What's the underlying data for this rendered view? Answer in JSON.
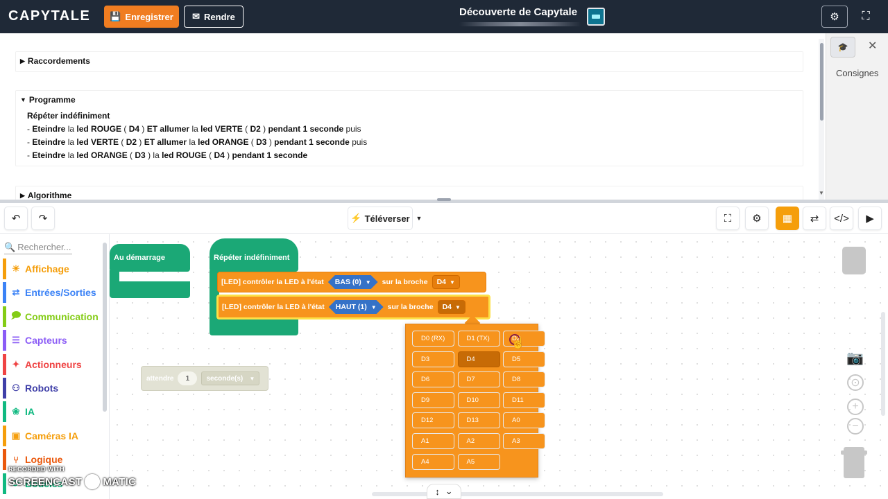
{
  "header": {
    "brand": "CAPYTALE",
    "save_label": "Enregistrer",
    "render_label": "Rendre",
    "doc_title": "Découverte de Capytale"
  },
  "instructions": {
    "sections": {
      "raccordements": "Raccordements",
      "programme": "Programme",
      "algorithme": "Algorithme"
    },
    "programme_body": {
      "intro": "Répéter indéfiniment",
      "lines": [
        [
          {
            "t": "- ",
            "b": false
          },
          {
            "t": "Eteindre",
            "b": true
          },
          {
            "t": " la ",
            "b": false
          },
          {
            "t": "led ROUGE",
            "b": true
          },
          {
            "t": " ( ",
            "b": false
          },
          {
            "t": "D4",
            "b": true
          },
          {
            "t": " ) ",
            "b": false
          },
          {
            "t": "ET allumer",
            "b": true
          },
          {
            "t": " la ",
            "b": false
          },
          {
            "t": "led VERTE",
            "b": true
          },
          {
            "t": " ( ",
            "b": false
          },
          {
            "t": "D2",
            "b": true
          },
          {
            "t": " ) ",
            "b": false
          },
          {
            "t": "pendant 1 seconde",
            "b": true
          },
          {
            "t": " puis",
            "b": false
          }
        ],
        [
          {
            "t": "- ",
            "b": false
          },
          {
            "t": "Eteindre",
            "b": true
          },
          {
            "t": " la ",
            "b": false
          },
          {
            "t": "led VERTE",
            "b": true
          },
          {
            "t": " ( ",
            "b": false
          },
          {
            "t": "D2",
            "b": true
          },
          {
            "t": " ) ",
            "b": false
          },
          {
            "t": "ET allumer",
            "b": true
          },
          {
            "t": " la ",
            "b": false
          },
          {
            "t": "led ORANGE",
            "b": true
          },
          {
            "t": " ( ",
            "b": false
          },
          {
            "t": "D3",
            "b": true
          },
          {
            "t": " ) ",
            "b": false
          },
          {
            "t": "pendant 1 seconde",
            "b": true
          },
          {
            "t": " puis",
            "b": false
          }
        ],
        [
          {
            "t": "- ",
            "b": false
          },
          {
            "t": "Eteindre",
            "b": true
          },
          {
            "t": " la ",
            "b": false
          },
          {
            "t": "led ORANGE",
            "b": true
          },
          {
            "t": " ( ",
            "b": false
          },
          {
            "t": "D3",
            "b": true
          },
          {
            "t": " )  la ",
            "b": false
          },
          {
            "t": "led ROUGE",
            "b": true
          },
          {
            "t": " ( ",
            "b": false
          },
          {
            "t": "D4",
            "b": true
          },
          {
            "t": " ) ",
            "b": false
          },
          {
            "t": "pendant 1 seconde",
            "b": true
          }
        ]
      ]
    }
  },
  "side_panel": {
    "label": "Consignes"
  },
  "toolbar": {
    "upload_label": "Téléverser"
  },
  "categories": {
    "search_placeholder": "Rechercher...",
    "items": [
      {
        "label": "Affichage",
        "color": "#f59e0b",
        "icon": "sun-icon"
      },
      {
        "label": "Entrées/Sorties",
        "color": "#3b82f6",
        "icon": "arrows-icon"
      },
      {
        "label": "Communication",
        "color": "#84cc16",
        "icon": "chat-icon"
      },
      {
        "label": "Capteurs",
        "color": "#8b5cf6",
        "icon": "sensor-icon"
      },
      {
        "label": "Actionneurs",
        "color": "#ef4444",
        "icon": "actuator-icon"
      },
      {
        "label": "Robots",
        "color": "#3f3fa8",
        "icon": "robot-icon"
      },
      {
        "label": "IA",
        "color": "#10b981",
        "icon": "brain-icon"
      },
      {
        "label": "Caméras IA",
        "color": "#f59e0b",
        "icon": "camera-icon"
      },
      {
        "label": "Logique",
        "color": "#ea580c",
        "icon": "branch-icon"
      },
      {
        "label": "Boucles",
        "color": "#10b981",
        "icon": "loop-icon"
      }
    ]
  },
  "blocks": {
    "start_label": "Au démarrage",
    "repeat_label": "Répéter indéfiniment",
    "led_block_1": {
      "prefix": "[LED] contrôler la LED à l'état",
      "state": "BAS (0)",
      "suffix": "sur la broche",
      "pin": "D4"
    },
    "led_block_2": {
      "prefix": "[LED] contrôler la LED à l'état",
      "state": "HAUT (1)",
      "suffix": "sur la broche",
      "pin": "D4"
    },
    "wait_block": {
      "label": "attendre",
      "value": "1",
      "unit": "seconde(s)"
    }
  },
  "pin_dropdown": {
    "items": [
      "D0 (RX)",
      "D1 (TX)",
      "D2",
      "D3",
      "D4",
      "D5",
      "D6",
      "D7",
      "D8",
      "D9",
      "D10",
      "D11",
      "D12",
      "D13",
      "A0",
      "A1",
      "A2",
      "A3",
      "A4",
      "A5"
    ],
    "selected": "D4"
  },
  "watermark": {
    "top": "RECORDED WITH",
    "left": "SCREENCAST",
    "right": "MATIC"
  }
}
